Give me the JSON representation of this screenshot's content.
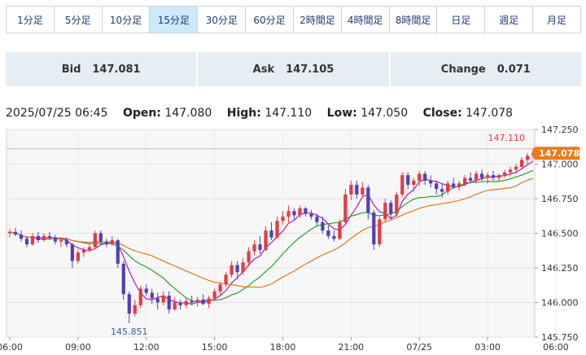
{
  "tabs": [
    {
      "label": "1分足",
      "active": false
    },
    {
      "label": "5分足",
      "active": false
    },
    {
      "label": "10分足",
      "active": false
    },
    {
      "label": "15分足",
      "active": true
    },
    {
      "label": "30分足",
      "active": false
    },
    {
      "label": "60分足",
      "active": false
    },
    {
      "label": "2時間足",
      "active": false
    },
    {
      "label": "4時間足",
      "active": false
    },
    {
      "label": "8時間足",
      "active": false
    },
    {
      "label": "日足",
      "active": false
    },
    {
      "label": "週足",
      "active": false
    },
    {
      "label": "月足",
      "active": false
    }
  ],
  "quote": {
    "bid_label": "Bid",
    "bid": "147.081",
    "ask_label": "Ask",
    "ask": "147.105",
    "change_label": "Change",
    "change": "0.071"
  },
  "ohlc": {
    "time": "2025/07/25 06:45",
    "open_label": "Open:",
    "open": "147.080",
    "high_label": "High:",
    "high": "147.110",
    "low_label": "Low:",
    "low": "147.050",
    "close_label": "Close:",
    "close": "147.078"
  },
  "chart_data": {
    "type": "candlestick",
    "ylim": [
      145.75,
      147.25
    ],
    "yticks": [
      "147.250",
      "147.000",
      "146.750",
      "146.500",
      "146.250",
      "146.000",
      "145.750"
    ],
    "yvalues": [
      147.25,
      147.0,
      146.75,
      146.5,
      146.25,
      146.0,
      145.75
    ],
    "xticks": [
      {
        "label": "06:00",
        "t": 0
      },
      {
        "label": "09:00",
        "t": 12
      },
      {
        "label": "12:00",
        "t": 24
      },
      {
        "label": "15:00",
        "t": 36
      },
      {
        "label": "18:00",
        "t": 48
      },
      {
        "label": "21:00",
        "t": 60
      },
      {
        "label": "07/25",
        "t": 72
      },
      {
        "label": "03:00",
        "t": 84
      },
      {
        "label": "06:00",
        "t": 96
      }
    ],
    "last_price": "147.078",
    "last_price_value": 147.078,
    "high_line_value": 147.11,
    "high_label": "147.110",
    "high_label_value": 147.11,
    "low_label": "145.851",
    "low_label_value": 145.851,
    "low_label_t": 21,
    "colors": {
      "up": "#e8393f",
      "down": "#5140b8",
      "ma_fast": "#a81fb5",
      "ma_mid": "#2ca02c",
      "ma_slow": "#e0781e",
      "price_tag": "#ee7a17",
      "high_line": "#eeb08a"
    },
    "candles": [
      [
        146.5,
        146.53,
        146.47,
        146.51
      ],
      [
        146.51,
        146.54,
        146.48,
        146.49
      ],
      [
        146.49,
        146.52,
        146.44,
        146.46
      ],
      [
        146.46,
        146.48,
        146.4,
        146.42
      ],
      [
        146.42,
        146.5,
        146.41,
        146.48
      ],
      [
        146.48,
        146.51,
        146.43,
        146.45
      ],
      [
        146.45,
        146.5,
        146.44,
        146.48
      ],
      [
        146.48,
        146.51,
        146.45,
        146.47
      ],
      [
        146.47,
        146.49,
        146.42,
        146.44
      ],
      [
        146.44,
        146.47,
        146.4,
        146.45
      ],
      [
        146.45,
        146.47,
        146.4,
        146.42
      ],
      [
        146.42,
        146.43,
        146.25,
        146.3
      ],
      [
        146.3,
        146.38,
        146.28,
        146.36
      ],
      [
        146.36,
        146.4,
        146.33,
        146.38
      ],
      [
        146.38,
        146.42,
        146.37,
        146.4
      ],
      [
        146.4,
        146.52,
        146.39,
        146.5
      ],
      [
        146.5,
        146.52,
        146.42,
        146.44
      ],
      [
        146.44,
        146.46,
        146.4,
        146.42
      ],
      [
        146.42,
        146.48,
        146.41,
        146.45
      ],
      [
        146.45,
        146.46,
        146.25,
        146.28
      ],
      [
        146.28,
        146.3,
        146.02,
        146.06
      ],
      [
        146.06,
        146.08,
        145.85,
        145.92
      ],
      [
        145.92,
        146.02,
        145.9,
        145.98
      ],
      [
        145.98,
        146.12,
        145.96,
        146.1
      ],
      [
        146.1,
        146.13,
        146.05,
        146.07
      ],
      [
        146.07,
        146.1,
        145.99,
        146.03
      ],
      [
        146.03,
        146.07,
        145.95,
        146.0
      ],
      [
        146.0,
        146.08,
        145.98,
        146.05
      ],
      [
        146.05,
        146.08,
        145.92,
        145.95
      ],
      [
        145.95,
        146.04,
        145.94,
        146.0
      ],
      [
        146.0,
        146.02,
        145.95,
        145.98
      ],
      [
        145.98,
        146.03,
        145.96,
        146.01
      ],
      [
        146.01,
        146.05,
        145.98,
        146.0
      ],
      [
        146.0,
        146.04,
        145.97,
        146.02
      ],
      [
        146.02,
        146.06,
        145.98,
        145.99
      ],
      [
        145.99,
        146.05,
        145.96,
        146.03
      ],
      [
        146.03,
        146.1,
        146.01,
        146.08
      ],
      [
        146.08,
        146.15,
        146.05,
        146.13
      ],
      [
        146.13,
        146.22,
        146.11,
        146.2
      ],
      [
        146.2,
        146.3,
        146.18,
        146.27
      ],
      [
        146.27,
        146.3,
        146.17,
        146.22
      ],
      [
        146.22,
        146.32,
        146.2,
        146.29
      ],
      [
        146.29,
        146.4,
        146.26,
        146.37
      ],
      [
        146.37,
        146.45,
        146.34,
        146.42
      ],
      [
        146.42,
        146.48,
        146.35,
        146.38
      ],
      [
        146.38,
        146.55,
        146.37,
        146.52
      ],
      [
        146.52,
        146.58,
        146.45,
        146.47
      ],
      [
        146.47,
        146.62,
        146.46,
        146.59
      ],
      [
        146.59,
        146.66,
        146.56,
        146.62
      ],
      [
        146.62,
        146.7,
        146.58,
        146.66
      ],
      [
        146.66,
        146.68,
        146.6,
        146.63
      ],
      [
        146.63,
        146.7,
        146.61,
        146.68
      ],
      [
        146.68,
        146.69,
        146.62,
        146.64
      ],
      [
        146.64,
        146.67,
        146.6,
        146.62
      ],
      [
        146.62,
        146.64,
        146.55,
        146.58
      ],
      [
        146.58,
        146.62,
        146.5,
        146.52
      ],
      [
        146.52,
        146.56,
        146.46,
        146.48
      ],
      [
        146.48,
        146.52,
        146.44,
        146.46
      ],
      [
        146.46,
        146.6,
        146.45,
        146.58
      ],
      [
        146.58,
        146.82,
        146.56,
        146.78
      ],
      [
        146.78,
        146.88,
        146.74,
        146.85
      ],
      [
        146.85,
        146.88,
        146.75,
        146.78
      ],
      [
        146.78,
        146.87,
        146.76,
        146.83
      ],
      [
        146.83,
        146.85,
        146.6,
        146.65
      ],
      [
        146.65,
        146.67,
        146.38,
        146.42
      ],
      [
        146.42,
        146.62,
        146.4,
        146.6
      ],
      [
        146.6,
        146.75,
        146.58,
        146.72
      ],
      [
        146.72,
        146.74,
        146.6,
        146.64
      ],
      [
        146.64,
        146.8,
        146.62,
        146.78
      ],
      [
        146.78,
        146.94,
        146.76,
        146.92
      ],
      [
        146.92,
        146.94,
        146.82,
        146.85
      ],
      [
        146.85,
        146.9,
        146.8,
        146.88
      ],
      [
        146.88,
        146.95,
        146.84,
        146.93
      ],
      [
        146.93,
        146.95,
        146.85,
        146.88
      ],
      [
        146.88,
        146.92,
        146.83,
        146.86
      ],
      [
        146.86,
        146.88,
        146.78,
        146.82
      ],
      [
        146.82,
        146.86,
        146.76,
        146.8
      ],
      [
        146.8,
        146.88,
        146.78,
        146.86
      ],
      [
        146.86,
        146.9,
        146.82,
        146.84
      ],
      [
        146.84,
        146.88,
        146.81,
        146.86
      ],
      [
        146.86,
        146.92,
        146.84,
        146.9
      ],
      [
        146.9,
        146.94,
        146.86,
        146.88
      ],
      [
        146.88,
        146.95,
        146.86,
        146.93
      ],
      [
        146.93,
        146.96,
        146.88,
        146.9
      ],
      [
        146.9,
        146.94,
        146.86,
        146.92
      ],
      [
        146.92,
        146.95,
        146.88,
        146.9
      ],
      [
        146.9,
        146.93,
        146.87,
        146.92
      ],
      [
        146.92,
        146.96,
        146.9,
        146.94
      ],
      [
        146.94,
        146.98,
        146.91,
        146.96
      ],
      [
        146.96,
        147.0,
        146.93,
        146.98
      ],
      [
        146.98,
        147.05,
        146.96,
        147.03
      ],
      [
        147.03,
        147.08,
        147.0,
        147.06
      ],
      [
        147.06,
        147.11,
        147.04,
        147.08
      ]
    ]
  }
}
